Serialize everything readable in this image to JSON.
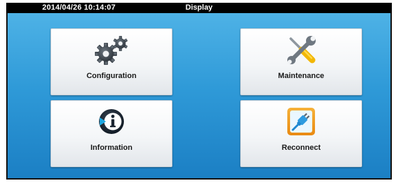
{
  "header": {
    "datetime": "2014/04/26  10:14:07",
    "title": "Display"
  },
  "tiles": [
    {
      "label": "Configuration",
      "icon": "gears-icon"
    },
    {
      "label": "Maintenance",
      "icon": "wrench-screwdriver-icon"
    },
    {
      "label": "Information",
      "icon": "info-icon"
    },
    {
      "label": "Reconnect",
      "icon": "plug-icon"
    }
  ],
  "colors": {
    "background_top": "#4eb2e6",
    "background_bottom": "#1b7fc4",
    "titlebar": "#000000"
  }
}
